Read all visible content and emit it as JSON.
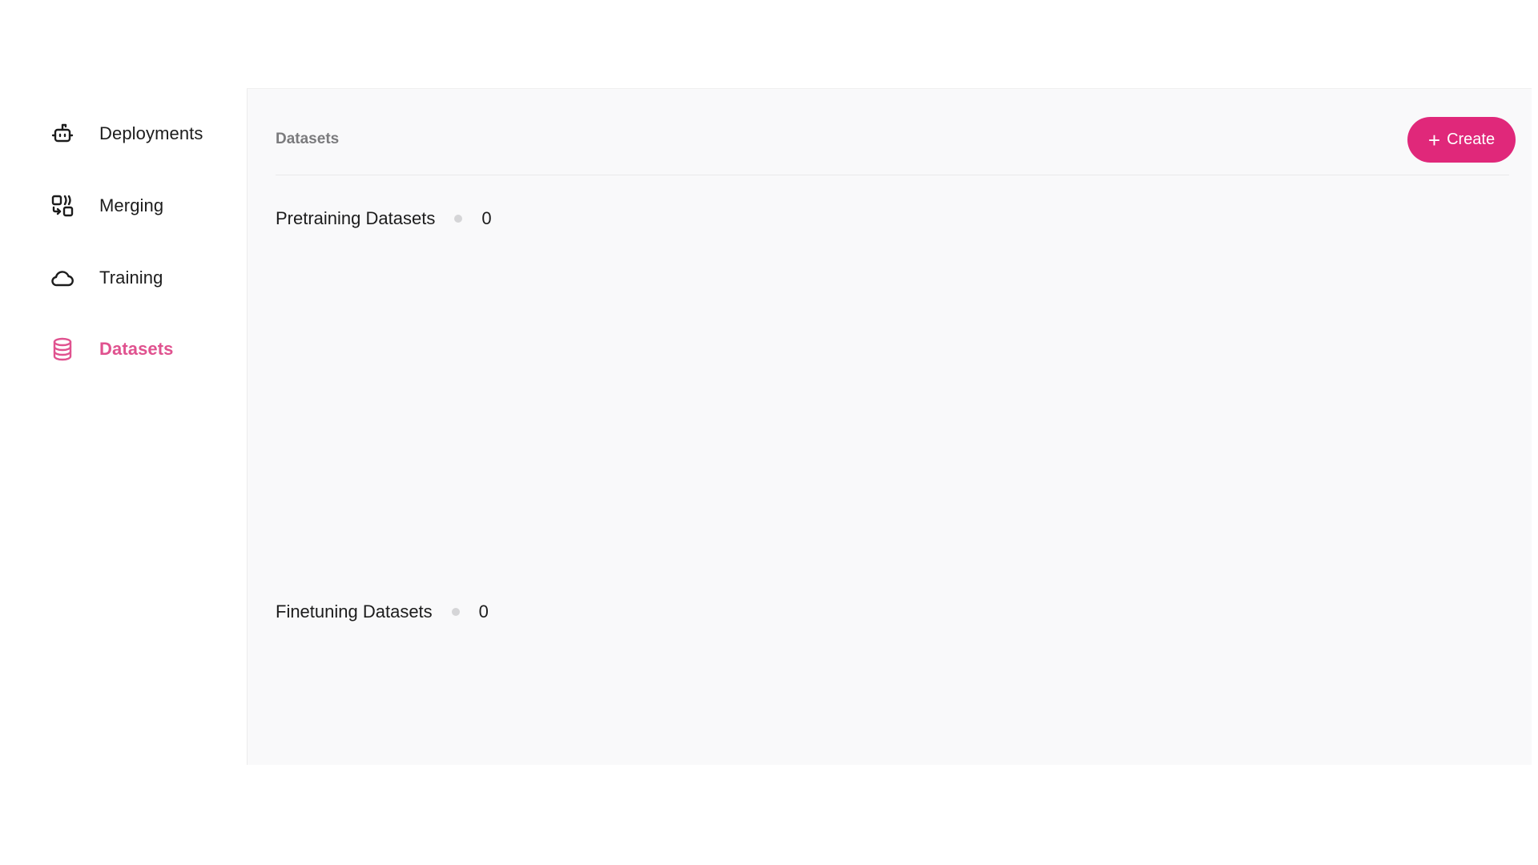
{
  "sidebar": {
    "items": [
      {
        "label": "Deployments",
        "icon": "bot-icon",
        "active": false
      },
      {
        "label": "Merging",
        "icon": "merge-icon",
        "active": false
      },
      {
        "label": "Training",
        "icon": "cloud-icon",
        "active": false
      },
      {
        "label": "Datasets",
        "icon": "database-icon",
        "active": true
      }
    ]
  },
  "header": {
    "title": "Datasets",
    "create_button": {
      "icon": "plus-icon",
      "label": "Create"
    }
  },
  "sections": [
    {
      "title": "Pretraining Datasets",
      "count": "0"
    },
    {
      "title": "Finetuning Datasets",
      "count": "0"
    }
  ],
  "colors": {
    "accent": "#e0287a",
    "active_nav": "#e0528f",
    "panel_bg": "#f9f9fa",
    "muted_text": "#7b7b7d",
    "status_dot": "#d5d5d7"
  }
}
